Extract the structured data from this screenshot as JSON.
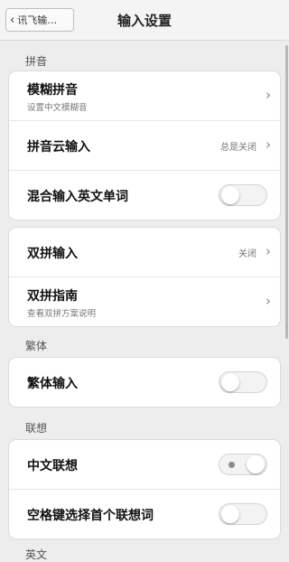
{
  "nav": {
    "back_label": "讯飞输…",
    "title": "输入设置"
  },
  "sections": {
    "pinyin": "拼音",
    "traditional": "繁体",
    "association": "联想",
    "partial_next": "英文"
  },
  "pinyin_card": {
    "fuzzy": {
      "label": "模糊拼音",
      "sub": "设置中文模糊音"
    },
    "cloud": {
      "label": "拼音云输入",
      "value": "总是关闭"
    },
    "mixed": {
      "label": "混合输入英文单词",
      "state": "off"
    }
  },
  "shuangpin_card": {
    "input": {
      "label": "双拼输入",
      "value": "关闭"
    },
    "guide": {
      "label": "双拼指南",
      "sub": "查看双拼方案说明"
    }
  },
  "traditional_card": {
    "input": {
      "label": "繁体输入",
      "state": "off"
    }
  },
  "association_card": {
    "chinese": {
      "label": "中文联想",
      "state": "on"
    },
    "space": {
      "label": "空格键选择首个联想词",
      "state": "off"
    }
  }
}
